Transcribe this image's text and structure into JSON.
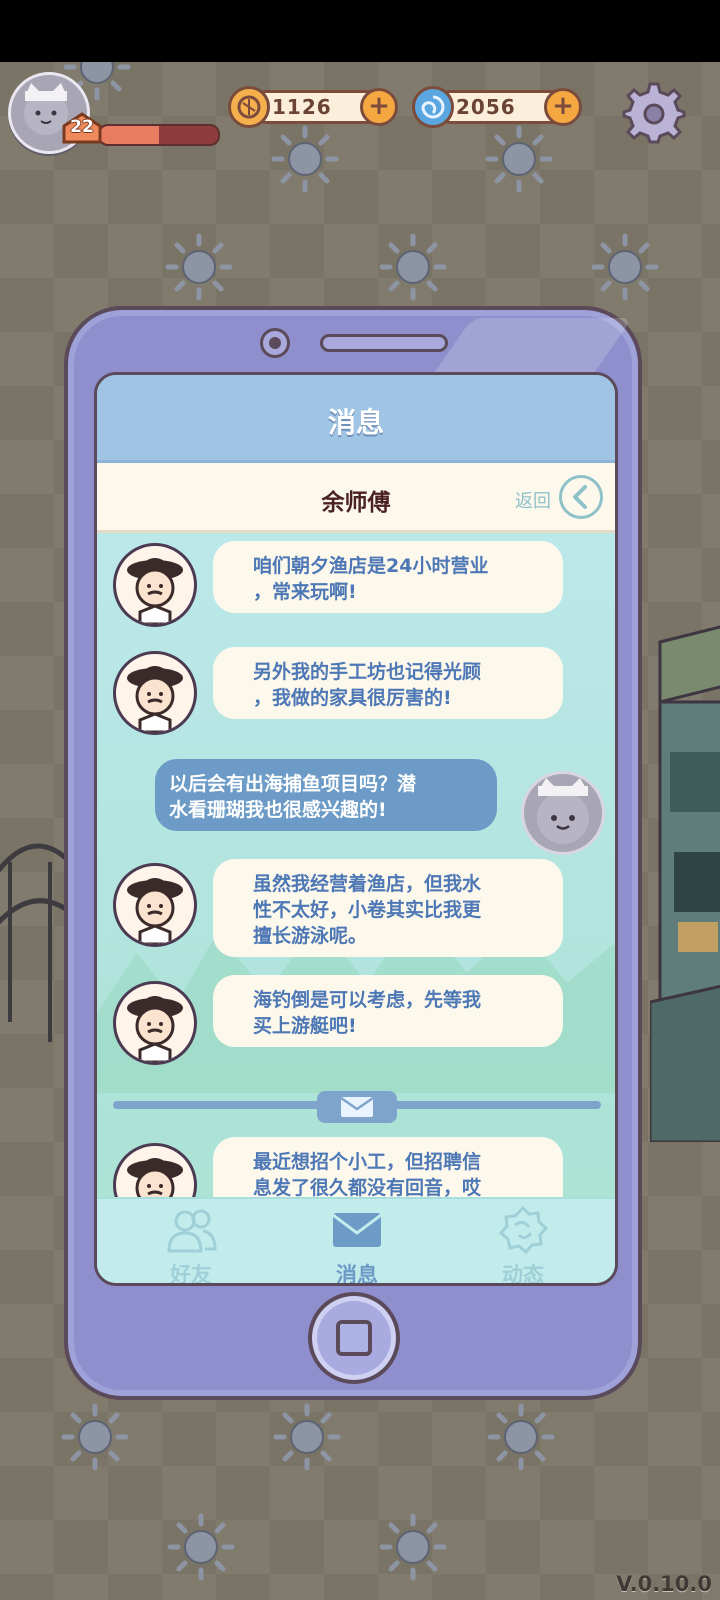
{
  "hud": {
    "level": "22",
    "xp_fraction": 0.5,
    "coins": "1126",
    "gems": "2056",
    "plus_symbol": "+"
  },
  "phone": {
    "screen_title": "消息",
    "contact_name": "余师傅",
    "back_label": "返回",
    "messages": [
      {
        "from": "npc",
        "lines": [
          "咱们朝夕渔店是24小时营业",
          "，常来玩啊!"
        ]
      },
      {
        "from": "npc",
        "lines": [
          "另外我的手工坊也记得光顾",
          "，我做的家具很厉害的!"
        ]
      },
      {
        "from": "player",
        "lines": [
          "以后会有出海捕鱼项目吗？潜",
          "水看珊瑚我也很感兴趣的!"
        ]
      },
      {
        "from": "npc",
        "lines": [
          "虽然我经营着渔店，但我水",
          "性不太好，小卷其实比我更",
          "擅长游泳呢。"
        ]
      },
      {
        "from": "npc",
        "lines": [
          "海钓倒是可以考虑，先等我",
          "买上游艇吧!"
        ]
      },
      {
        "from": "npc",
        "lines": [
          "最近想招个小工，但招聘信",
          "息发了很久都没有回音，哎"
        ]
      }
    ],
    "nav": [
      {
        "label": "好友",
        "icon": "friends-icon",
        "active": false
      },
      {
        "label": "消息",
        "icon": "mail-icon",
        "active": true
      },
      {
        "label": "动态",
        "icon": "moments-icon",
        "active": false
      }
    ]
  },
  "version": "V.0.10.0",
  "colors": {
    "accent_blue": "#6b9bc6",
    "bubble_text": "#4d78b5",
    "phone_body": "#8e8fcc",
    "nav_active": "#6b9bc6",
    "nav_inactive": "#9fd0d8"
  }
}
